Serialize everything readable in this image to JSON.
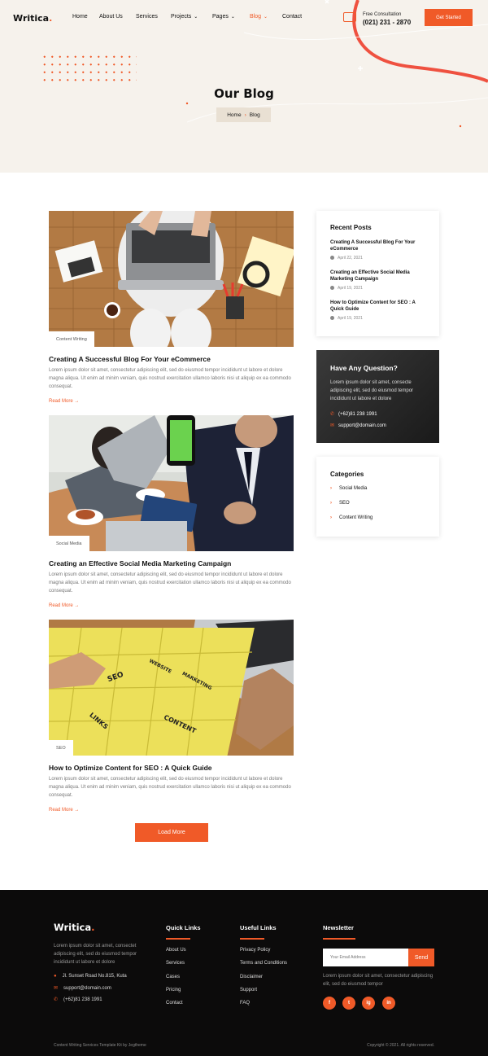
{
  "header": {
    "logo_text": "Writica",
    "logo_dot": ".",
    "nav": [
      "Home",
      "About Us",
      "Services",
      "Projects",
      "Pages",
      "Blog",
      "Contact"
    ],
    "consult_label": "Free Consultation",
    "consult_phone": "(021) 231 - 2870",
    "cta_label": "Get Started",
    "accent_color": "#f05a28"
  },
  "hero": {
    "title": "Our Blog",
    "breadcrumb": {
      "home": "Home",
      "current": "Blog"
    }
  },
  "posts": [
    {
      "tag": "Content Writing",
      "title": "Creating A Successful Blog For Your eCommerce",
      "excerpt": "Lorem ipsum dolor sit amet, consectetur adipiscing elit, sed do eiusmod tempor incididunt ut labore et dolore magna aliqua. Ut enim ad minim veniam, quis nostrud exercitation ullamco laboris nisi ut aliquip ex ea commodo consequat.",
      "read_more": "Read More"
    },
    {
      "tag": "Social Media",
      "title": "Creating an Effective Social Media Marketing Campaign",
      "excerpt": "Lorem ipsum dolor sit amet, consectetur adipiscing elit, sed do eiusmod tempor incididunt ut labore et dolore magna aliqua. Ut enim ad minim veniam, quis nostrud exercitation ullamco laboris nisi ut aliquip ex ea commodo consequat.",
      "read_more": "Read More"
    },
    {
      "tag": "SEO",
      "title": "How to Optimize Content for SEO : A Quick Guide",
      "excerpt": "Lorem ipsum dolor sit amet, consectetur adipiscing elit, sed do eiusmod tempor incididunt ut labore et dolore magna aliqua. Ut enim ad minim veniam, quis nostrud exercitation ullamco laboris nisi ut aliquip ex ea commodo consequat.",
      "read_more": "Read More"
    }
  ],
  "load_more": "Load More",
  "sidebar": {
    "recent": {
      "title": "Recent Posts",
      "items": [
        {
          "title": "Creating A Successful Blog For Your eCommerce",
          "date": "April 22, 2021"
        },
        {
          "title": "Creating an Effective Social Media Marketing Campaign",
          "date": "April 19, 2021"
        },
        {
          "title": "How to Optimize Content for SEO : A Quick Guide",
          "date": "April 19, 2021"
        }
      ]
    },
    "question": {
      "title": "Have Any Question?",
      "text": "Lorem ipsum dolor sit amet, consecte adipiscing elit, sed do eiusmod tempor incididunt ut labore et dolore",
      "phone": "(+62)81 238 1991",
      "email": "support@domain.com"
    },
    "categories": {
      "title": "Categories",
      "items": [
        "Social Media",
        "SEO",
        "Content Writing"
      ]
    }
  },
  "footer": {
    "logo_text": "Writica",
    "logo_dot": ".",
    "desc": "Lorem ipsum dolor sit amet, consectet adipiscing elit, sed do eiusmod tempor incididunt ut labore et dolore",
    "address": "Jl. Sunset Road No.815, Kuta",
    "email": "support@domain.com",
    "phone": "(+62)81 238 1991",
    "quick_links": {
      "title": "Quick Links",
      "items": [
        "About Us",
        "Services",
        "Cases",
        "Pricing",
        "Contact"
      ]
    },
    "useful_links": {
      "title": "Useful Links",
      "items": [
        "Privacy Policy",
        "Terms and Conditions",
        "Disclaimer",
        "Support",
        "FAQ"
      ]
    },
    "newsletter": {
      "title": "Newsletter",
      "placeholder": "Your Email Address",
      "send": "Send",
      "desc": "Lorem ipsum dolor sit amet, consectetur adipiscing elit, sed do eiusmod tempor"
    },
    "social": [
      "f",
      "t",
      "ig",
      "in"
    ],
    "credit": "Content Writing Services Template Kit by Jegtheme",
    "copyright": "Copyright © 2021. All rights reserved."
  }
}
